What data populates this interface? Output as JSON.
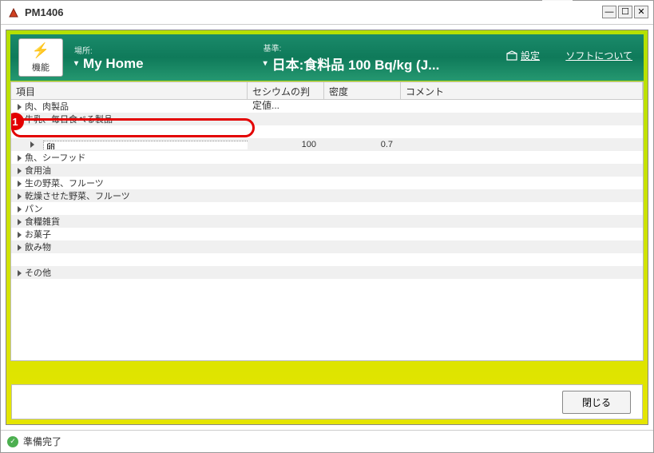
{
  "window": {
    "title": "PM1406"
  },
  "header": {
    "func_label": "機能",
    "location_label": "場所:",
    "location_value": "My Home",
    "standard_label": "基準:",
    "standard_value": "日本:食料品 100 Bq/kg (J...",
    "settings_label": "設定",
    "about_label": "ソフトについて"
  },
  "table": {
    "columns": [
      "項目",
      "セシウムの判定値...",
      "密度",
      "コメント"
    ],
    "rows": [
      {
        "label": "肉、肉製品",
        "cesium": "",
        "density": "",
        "comment": ""
      },
      {
        "label": "牛乳、毎日食べる製品",
        "cesium": "",
        "density": "",
        "comment": ""
      },
      {
        "label": "",
        "cesium": "",
        "density": "",
        "comment": ""
      },
      {
        "label": "卵",
        "cesium": "100",
        "density": "0.7",
        "comment": "",
        "selected": true
      },
      {
        "label": "魚、シーフッド",
        "cesium": "",
        "density": "",
        "comment": ""
      },
      {
        "label": "食用油",
        "cesium": "",
        "density": "",
        "comment": ""
      },
      {
        "label": "生の野菜、フルーツ",
        "cesium": "",
        "density": "",
        "comment": ""
      },
      {
        "label": "乾燥させた野菜、フルーツ",
        "cesium": "",
        "density": "",
        "comment": ""
      },
      {
        "label": "パン",
        "cesium": "",
        "density": "",
        "comment": ""
      },
      {
        "label": "食糧雑貨",
        "cesium": "",
        "density": "",
        "comment": ""
      },
      {
        "label": "お菓子",
        "cesium": "",
        "density": "",
        "comment": ""
      },
      {
        "label": "飲み物",
        "cesium": "",
        "density": "",
        "comment": ""
      },
      {
        "label": "",
        "cesium": "",
        "density": "",
        "comment": ""
      },
      {
        "label": "その他",
        "cesium": "",
        "density": "",
        "comment": ""
      }
    ]
  },
  "annotation": {
    "badge": "1"
  },
  "buttons": {
    "close": "閉じる"
  },
  "status": {
    "text": "準備完了"
  }
}
